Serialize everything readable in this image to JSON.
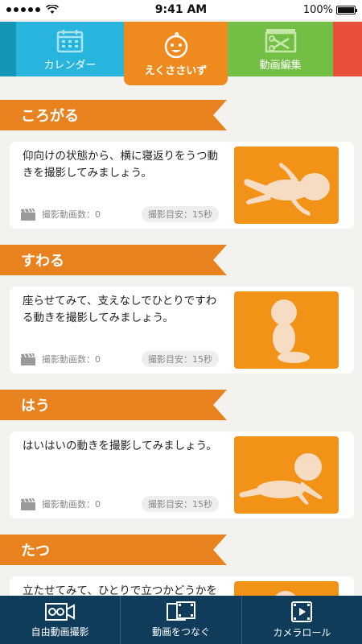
{
  "status_bar": {
    "time": "9:41 AM",
    "battery": "100%",
    "battery_level": 1.0
  },
  "tabs": [
    {
      "label": "カレンダー",
      "icon": "calendar-icon"
    },
    {
      "label": "えくささいず",
      "icon": "baby-face-icon",
      "active": true
    },
    {
      "label": "動画編集",
      "icon": "video-edit-icon"
    }
  ],
  "sections": [
    {
      "title": "ころがる",
      "description": "仰向けの状態から、横に寝返りをうつ動きを撮影してみましょう。",
      "count_label": "撮影動画数：0",
      "guide_label": "撮影目安：15秒",
      "image": "baby-lying-icon"
    },
    {
      "title": "すわる",
      "description": "座らせてみて、支えなしでひとりですわる動きを撮影してみましょう。",
      "count_label": "撮影動画数：0",
      "guide_label": "撮影目安：15秒",
      "image": "baby-sitting-icon"
    },
    {
      "title": "はう",
      "description": "はいはいの動きを撮影してみましょう。",
      "count_label": "撮影動画数：0",
      "guide_label": "撮影目安：15秒",
      "image": "baby-crawling-icon"
    },
    {
      "title": "たつ",
      "description": "立たせてみて、ひとりで立つかどうかを撮影してみましょう。",
      "count_label": "",
      "guide_label": "",
      "image": "baby-standing-icon"
    }
  ],
  "bottom_bar": [
    {
      "label": "自由動画撮影",
      "icon": "video-camera-icon"
    },
    {
      "label": "動画をつなぐ",
      "icon": "film-join-icon"
    },
    {
      "label": "カメラロール",
      "icon": "camera-roll-icon"
    }
  ],
  "colors": {
    "ribbon": "#e8821e",
    "active_tab": "#ee8a1e",
    "calendar_tab": "#27b5de",
    "edit_tab": "#73bf45",
    "bottom_bar": "#0e3c5a"
  }
}
